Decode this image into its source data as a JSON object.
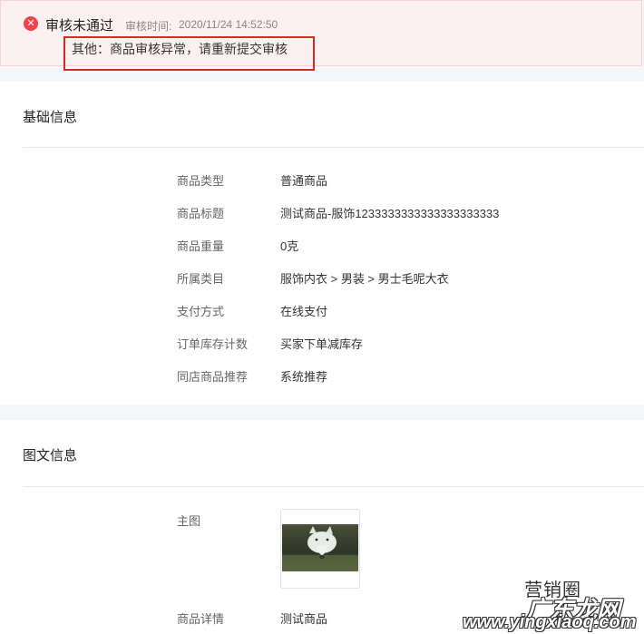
{
  "review": {
    "status": "审核未通过",
    "time_label": "审核时间:",
    "time_value": "2020/11/24 14:52:50",
    "reason": "其他：商品审核异常，请重新提交审核"
  },
  "basic_info": {
    "title": "基础信息",
    "rows": [
      {
        "label": "商品类型",
        "value": "普通商品"
      },
      {
        "label": "商品标题",
        "value": "测试商品-服饰1233333333333333333333"
      },
      {
        "label": "商品重量",
        "value": "0克"
      },
      {
        "label": "所属类目",
        "value": "服饰内衣 > 男装 > 男士毛呢大衣"
      },
      {
        "label": "支付方式",
        "value": "在线支付"
      },
      {
        "label": "订单库存计数",
        "value": "买家下单减库存"
      },
      {
        "label": "同店商品推荐",
        "value": "系统推荐"
      }
    ]
  },
  "media_info": {
    "title": "图文信息",
    "main_image_label": "主图",
    "detail_label": "商品详情",
    "detail_value": "测试商品"
  },
  "watermark": {
    "line1": "营销圈",
    "line2": "广东龙网",
    "line3": "www.yingxiaoq.com"
  },
  "colors": {
    "alert_bg": "#fdf0f0",
    "error_red": "#f0434b",
    "highlight_border": "#d92a2a"
  },
  "icons": {
    "status": "close-circle-icon"
  }
}
